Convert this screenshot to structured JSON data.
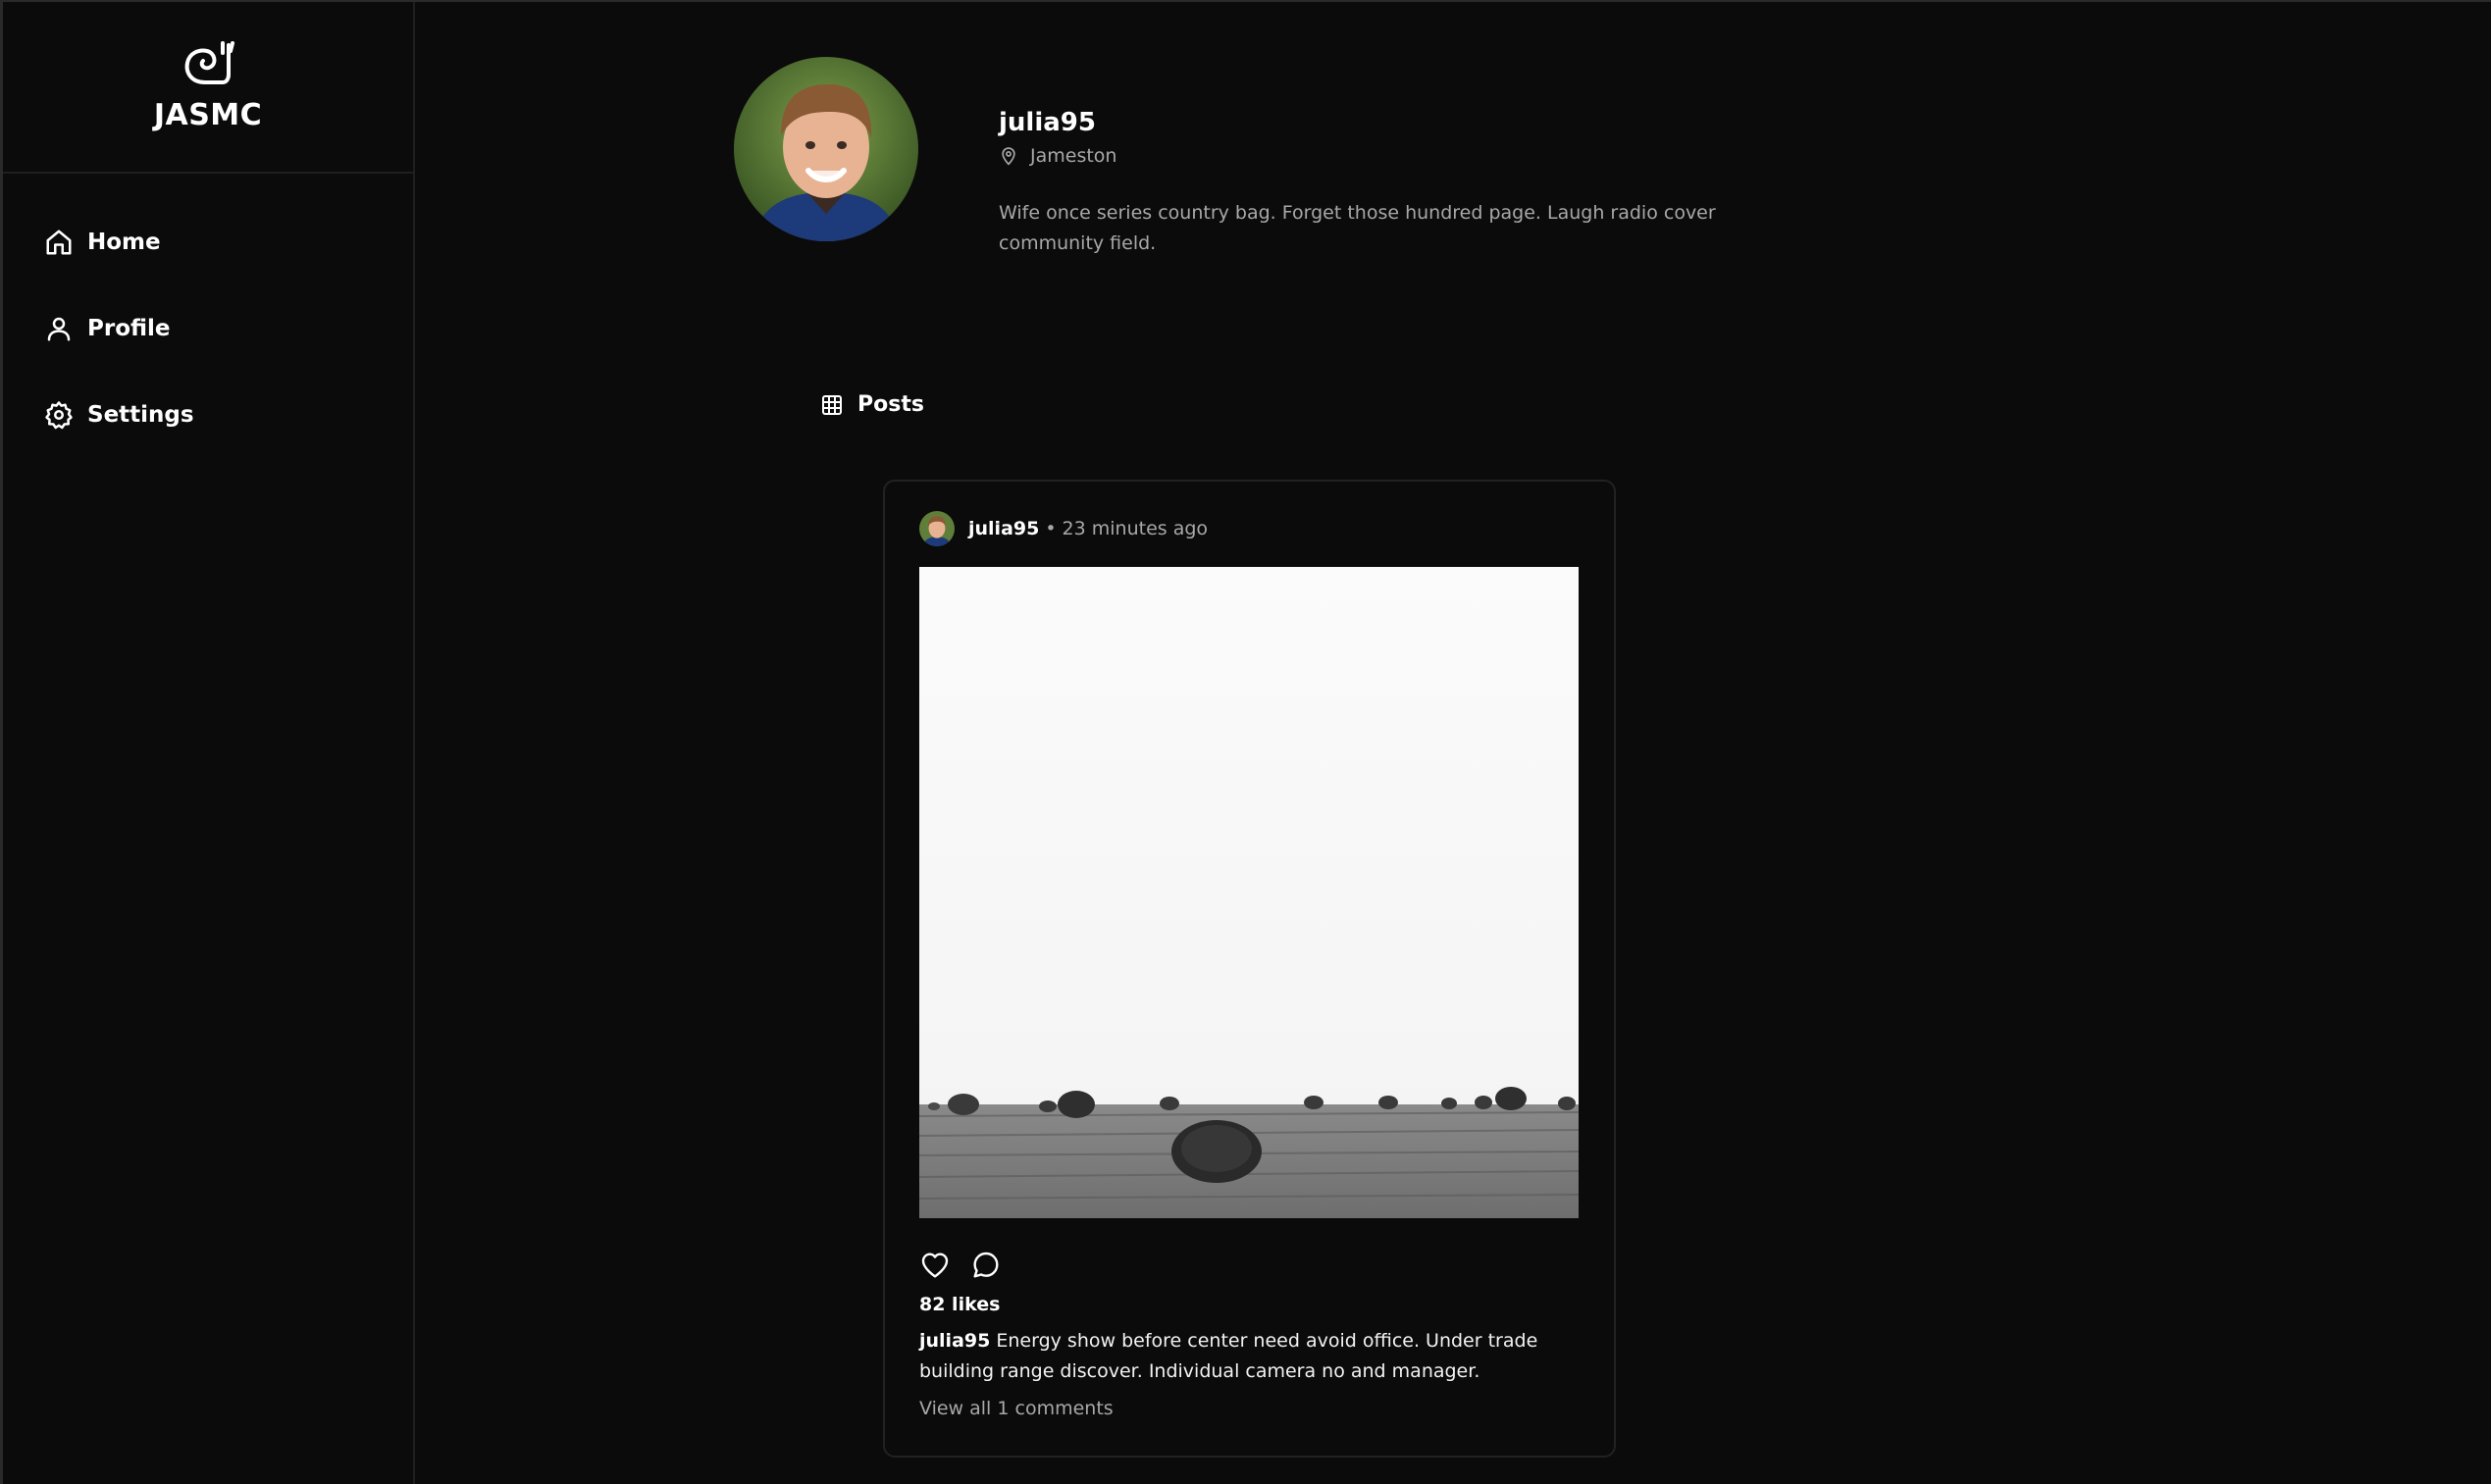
{
  "brand": {
    "name": "JASMC",
    "logo_icon": "snail-icon"
  },
  "nav": {
    "items": [
      {
        "label": "Home",
        "icon": "home-icon"
      },
      {
        "label": "Profile",
        "icon": "user-icon"
      },
      {
        "label": "Settings",
        "icon": "gear-icon"
      }
    ]
  },
  "profile": {
    "username": "julia95",
    "location": "Jameston",
    "bio": "Wife once series country bag. Forget those hundred page. Laugh radio cover community field."
  },
  "tabs": {
    "posts_label": "Posts"
  },
  "post": {
    "username": "julia95",
    "separator": "•",
    "time": "23 minutes ago",
    "likes": "82 likes",
    "caption_user": "julia95",
    "caption_text": "Energy show before center need avoid office. Under trade building range discover. Individual camera no and manager.",
    "comments_link": "View all 1 comments"
  },
  "colors": {
    "background": "#0b0b0b",
    "text_primary": "#ffffff",
    "text_secondary": "#a8a8a8",
    "border": "#222222"
  }
}
